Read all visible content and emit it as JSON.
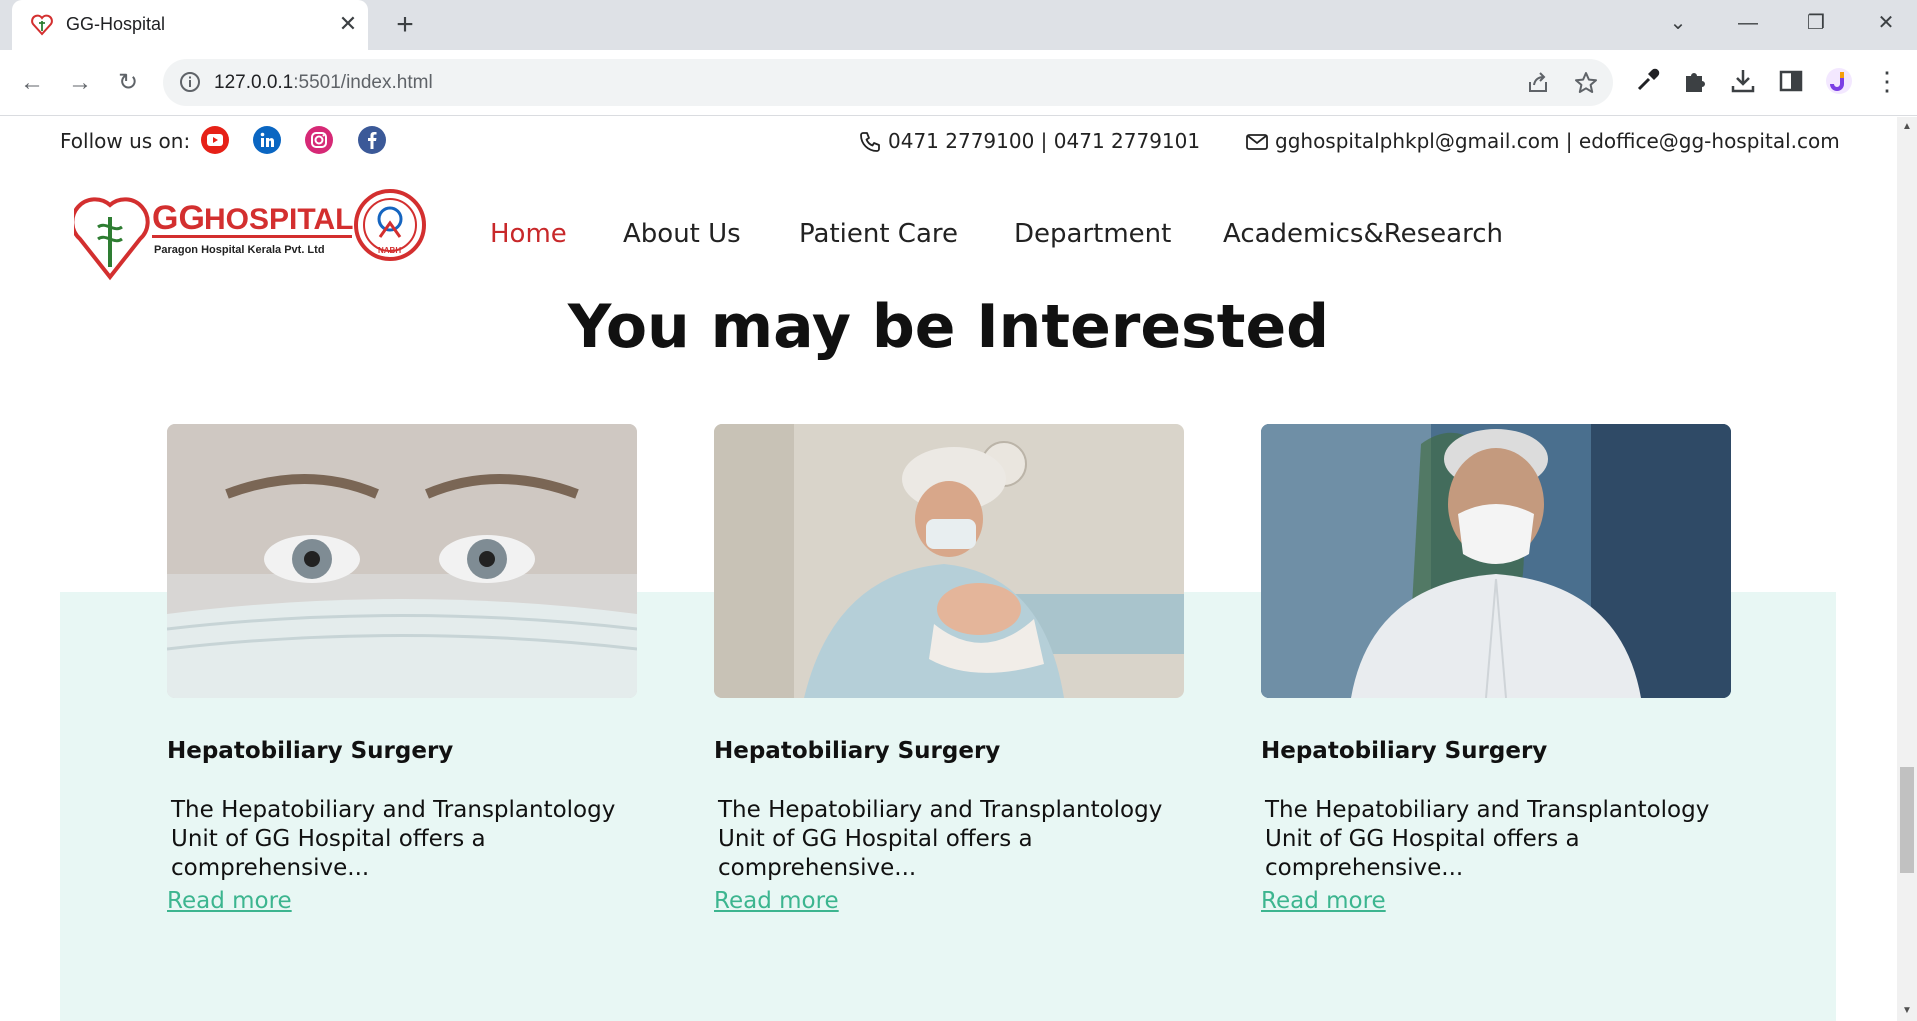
{
  "browser": {
    "tab_title": "GG-Hospital",
    "url_host": "127.0.0.1",
    "url_path": ":5501/index.html"
  },
  "topbar": {
    "follow_label": "Follow us on:",
    "phones": "0471 2779100 | 0471 2779101",
    "emails": "gghospitalphkpl@gmail.com | edoffice@gg-hospital.com"
  },
  "logo": {
    "brand_gg": "GG",
    "brand_hospital": "HOSPITAL",
    "tagline": "Paragon Hospital Kerala Pvt. Ltd",
    "badge_text": "NABH"
  },
  "nav": {
    "items": [
      "Home",
      "About Us",
      "Patient Care",
      "Department",
      "Academics&Research"
    ],
    "active_index": 0
  },
  "section": {
    "title": "You may be Interested"
  },
  "cards": [
    {
      "title": "Hepatobiliary Surgery",
      "desc": "The Hepatobiliary and Transplantology Unit of GG Hospital offers a comprehensive...",
      "link": "Read more"
    },
    {
      "title": "Hepatobiliary Surgery",
      "desc": "The Hepatobiliary and Transplantology Unit of GG Hospital offers a comprehensive...",
      "link": "Read more"
    },
    {
      "title": "Hepatobiliary Surgery",
      "desc": "The Hepatobiliary and Transplantology Unit of GG Hospital offers a comprehensive...",
      "link": "Read more"
    }
  ],
  "colors": {
    "accent_red": "#c8282a",
    "link_green": "#3cb58f",
    "band_bg": "#e8f7f4"
  }
}
